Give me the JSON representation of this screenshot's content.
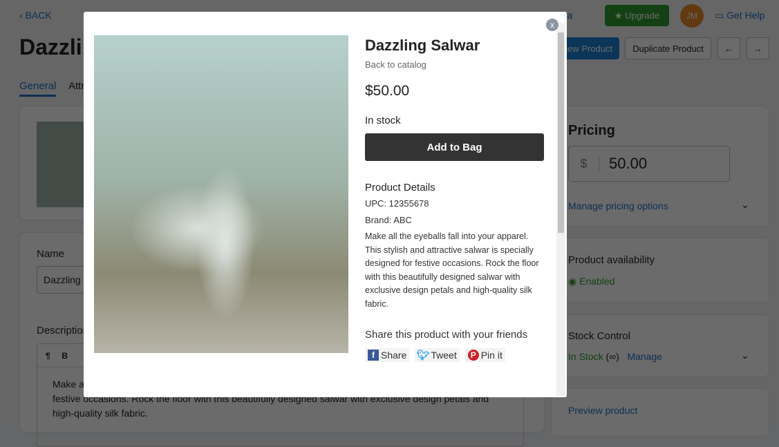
{
  "page": {
    "back": "BACK",
    "title": "Dazzling Salwar",
    "tabs": [
      "General",
      "Attributes"
    ],
    "header": {
      "extra": "tra",
      "upgrade": "Upgrade",
      "avatar": "JM",
      "help": "Get Help",
      "view": "View Product",
      "duplicate": "Duplicate Product"
    },
    "name_label": "Name",
    "name_value": "Dazzling Salwar",
    "desc_label": "Description",
    "desc_text": "Make all the eyeballs fall into your apparel. This stylish and attractive salwar is specially designed for festive occasions. Rock the floor with this beautifully designed salwar with exclusive design petals and high-quality silk fabric.",
    "pricing": {
      "title": "Pricing",
      "currency": "$",
      "value": "50.00",
      "manage": "Manage pricing options"
    },
    "availability": {
      "title": "Product availability",
      "status": "Enabled"
    },
    "stock": {
      "title": "Stock Control",
      "status": "In Stock",
      "infinity": "(∞)",
      "manage": "Manage"
    },
    "preview": "Preview product"
  },
  "modal": {
    "close": "x",
    "title": "Dazzling Salwar",
    "back": "Back to catalog",
    "price": "$50.00",
    "stock": "In stock",
    "add": "Add to Bag",
    "details_title": "Product Details",
    "upc": "UPC: 12355678",
    "brand": "Brand: ABC",
    "description": "Make all the eyeballs fall into your apparel. This stylish and attractive salwar is specially designed for festive occasions. Rock the floor with this beautifully designed salwar with exclusive design petals and high-quality silk fabric.",
    "share_title": "Share this product with your friends",
    "share": "Share",
    "tweet": "Tweet",
    "pin": "Pin it"
  }
}
